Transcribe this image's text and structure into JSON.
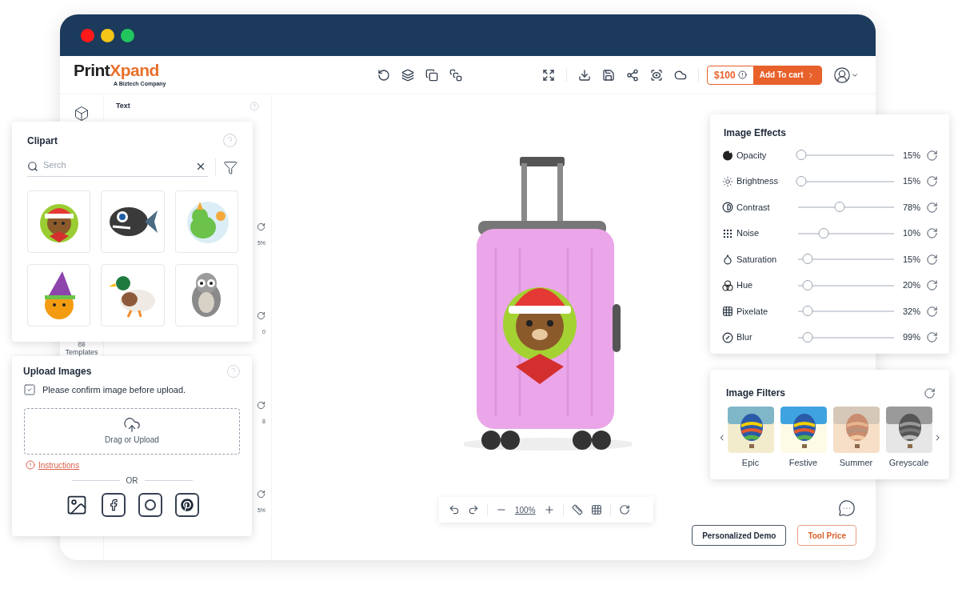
{
  "window": {
    "controls": [
      {
        "color": "#ff1a1a"
      },
      {
        "color": "#f5c518"
      },
      {
        "color": "#22c55e"
      }
    ]
  },
  "header": {
    "logo_dark": "Print",
    "logo_accent": "Xpand",
    "tagline": "A Biztech Company",
    "price": "$100",
    "cart_button": "Add To cart"
  },
  "side_panel": {
    "rail_label": "Templates",
    "title": "Text",
    "fragments": [
      "5%",
      "0",
      "8",
      "5%"
    ]
  },
  "clipart": {
    "title": "Clipart",
    "search": {
      "placeholder": "Serch"
    },
    "items": [
      {
        "kind": "bear"
      },
      {
        "kind": "fish"
      },
      {
        "kind": "dino"
      },
      {
        "kind": "pumpkin"
      },
      {
        "kind": "duck"
      },
      {
        "kind": "owl"
      }
    ]
  },
  "upload": {
    "title": "Upload Images",
    "confirm": {
      "label": "Please confirm image before upload.",
      "checked": true
    },
    "dropzone": "Drag or Upload",
    "instructions": "Instructions",
    "or": "OR",
    "sources": [
      {
        "kind": "gallery"
      },
      {
        "kind": "facebook"
      },
      {
        "kind": "instagram"
      },
      {
        "kind": "pinterest"
      }
    ]
  },
  "canvas_toolbar": {
    "zoom": "100%"
  },
  "buttons": {
    "demo": "Personalized Demo",
    "price": "Tool Price"
  },
  "image_effects": {
    "title": "Image Effects",
    "rows": [
      {
        "kind": "opacity",
        "label": "Opacity",
        "level": 0.03,
        "value": "15%"
      },
      {
        "kind": "brightness",
        "label": "Brightness",
        "level": 0.03,
        "value": "15%"
      },
      {
        "kind": "contrast",
        "label": "Contrast",
        "level": 0.43,
        "value": "78%"
      },
      {
        "kind": "noise",
        "label": "Noise",
        "level": 0.27,
        "value": "10%"
      },
      {
        "kind": "saturation",
        "label": "Saturation",
        "level": 0.1,
        "value": "15%"
      },
      {
        "kind": "hue",
        "label": "Hue",
        "level": 0.1,
        "value": "20%"
      },
      {
        "kind": "pixelate",
        "label": "Pixelate",
        "level": 0.1,
        "value": "32%"
      },
      {
        "kind": "blur",
        "label": "Blur",
        "level": 0.1,
        "value": "99%"
      }
    ]
  },
  "image_filters": {
    "title": "Image Filters",
    "items": [
      {
        "kind": "epic",
        "label": "Epic"
      },
      {
        "kind": "festive",
        "label": "Festive"
      },
      {
        "kind": "summer",
        "label": "Summer"
      },
      {
        "kind": "greyscale",
        "label": "Greyscale"
      }
    ]
  }
}
